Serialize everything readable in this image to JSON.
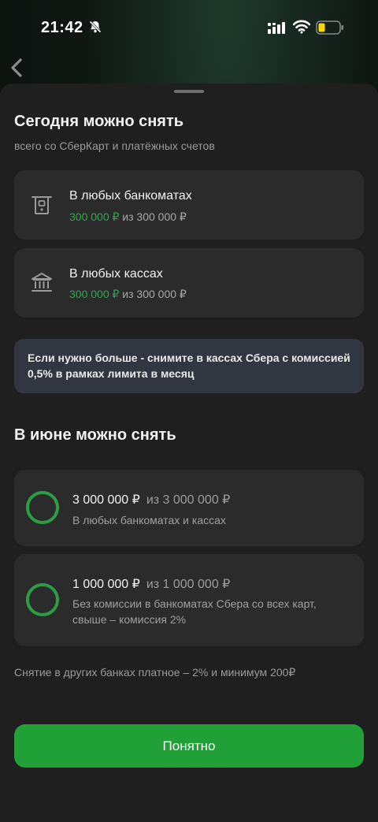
{
  "status_bar": {
    "time": "21:42"
  },
  "today": {
    "title": "Сегодня можно снять",
    "subtitle": "всего со СберКарт и платёжных счетов",
    "items": [
      {
        "title": "В любых банкоматах",
        "available": "300 000 ₽",
        "of": "из 300 000 ₽",
        "icon": "atm-icon"
      },
      {
        "title": "В любых кассах",
        "available": "300 000 ₽",
        "of": "из 300 000 ₽",
        "icon": "bank-building-icon"
      }
    ]
  },
  "info_banner": "Если нужно больше - снимите в кассах Сбера с комиссией 0,5% в рамках лимита в месяц",
  "month": {
    "title": "В июне можно снять",
    "items": [
      {
        "amount": "3 000 000 ₽",
        "of": "из 3 000 000 ₽",
        "description": "В любых банкоматах и кассах",
        "progress": 1.0
      },
      {
        "amount": "1 000 000 ₽",
        "of": "из 1 000 000 ₽",
        "description": "Без комиссии в банкоматах Сбера со всех карт, свыше – комиссия 2%",
        "progress": 1.0
      }
    ]
  },
  "footnote": "Снятие в других банках платное – 2% и минимум 200₽",
  "button_label": "Понятно",
  "colors": {
    "accent": "#21a038",
    "available_text": "#2ea84a",
    "sheet_bg": "#1f1f1f",
    "card_bg": "#2b2b2b"
  }
}
